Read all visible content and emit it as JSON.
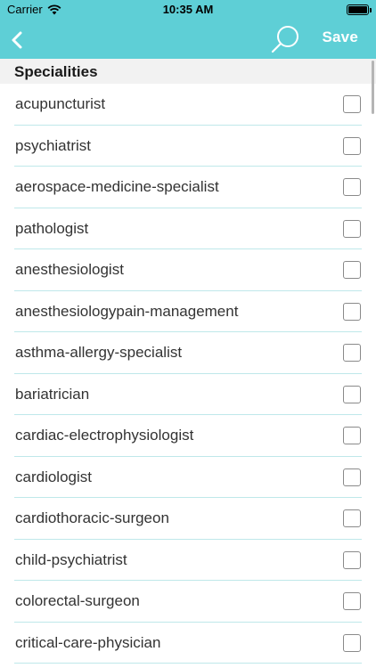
{
  "status_bar": {
    "carrier": "Carrier",
    "time": "10:35 AM",
    "battery_level": 1.0
  },
  "nav": {
    "back_icon": "chevron-left-icon",
    "search_icon": "search-icon",
    "save_label": "Save",
    "bar_color": "#5ecfd6"
  },
  "section": {
    "title": "Specialities"
  },
  "items": [
    {
      "label": "acupuncturist",
      "checked": false
    },
    {
      "label": "psychiatrist",
      "checked": false
    },
    {
      "label": "aerospace-medicine-specialist",
      "checked": false
    },
    {
      "label": "pathologist",
      "checked": false
    },
    {
      "label": "anesthesiologist",
      "checked": false
    },
    {
      "label": "anesthesiologypain-management",
      "checked": false
    },
    {
      "label": "asthma-allergy-specialist",
      "checked": false
    },
    {
      "label": "bariatrician",
      "checked": false
    },
    {
      "label": "cardiac-electrophysiologist",
      "checked": false
    },
    {
      "label": "cardiologist",
      "checked": false
    },
    {
      "label": "cardiothoracic-surgeon",
      "checked": false
    },
    {
      "label": "child-psychiatrist",
      "checked": false
    },
    {
      "label": "colorectal-surgeon",
      "checked": false
    },
    {
      "label": "critical-care-physician",
      "checked": false
    }
  ]
}
